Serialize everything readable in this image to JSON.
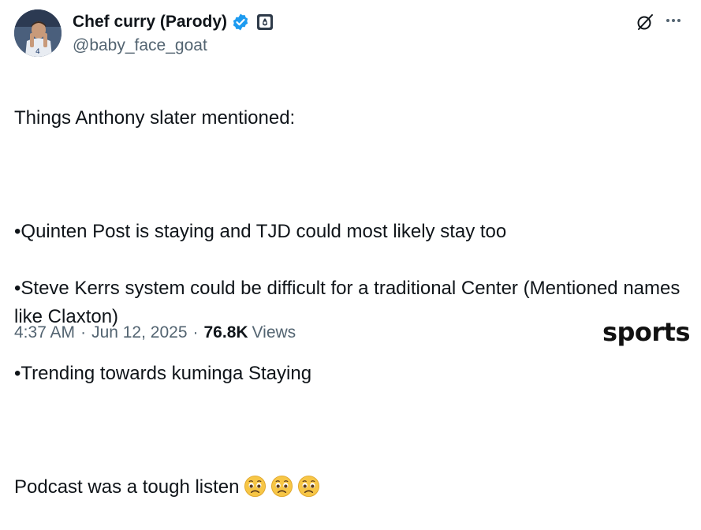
{
  "author": {
    "display_name": "Chef curry (Parody)",
    "handle": "@baby_face_goat",
    "verified": true,
    "badge_icon": "parody-badge-icon"
  },
  "tweet": {
    "line1": "Things Anthony slater mentioned:",
    "bullet1": "•Quinten Post is staying and TJD could most likely stay too",
    "bullet2": "•Steve Kerrs system could be difficult for a traditional Center (Mentioned names like Claxton)",
    "bullet3": "•Trending towards kuminga Staying",
    "closing": "Podcast was a tough listen",
    "emojis": [
      "pleading-face-emoji",
      "pleading-face-emoji",
      "pleading-face-emoji"
    ]
  },
  "meta": {
    "time": "4:37 AM",
    "date": "Jun 12, 2025",
    "views_count": "76.8K",
    "views_label": "Views",
    "separator": "·"
  },
  "watermark": {
    "text": "sports"
  },
  "colors": {
    "verified_blue": "#1d9bf0",
    "secondary_text": "#536471",
    "primary_text": "#0f1419"
  }
}
